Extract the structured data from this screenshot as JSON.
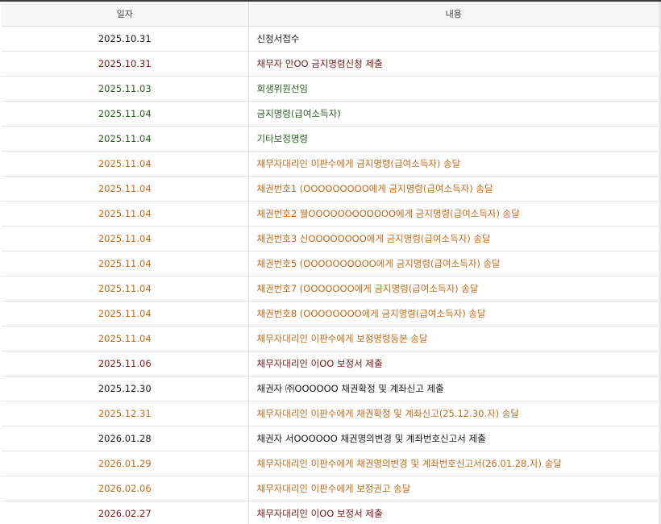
{
  "colors": {
    "black": "#1a1a1a",
    "red": "#7a1a18",
    "green": "#2b5e22",
    "orange": "#c46a17",
    "header_bg": "#f6f6f6"
  },
  "table": {
    "headers": {
      "date": "일자",
      "content": "내용"
    },
    "rows": [
      {
        "date": "2025.10.31",
        "content": "신청서접수",
        "color": "black"
      },
      {
        "date": "2025.10.31",
        "content": "채무자 안OO 금지명령신청 제출",
        "color": "red"
      },
      {
        "date": "2025.11.03",
        "content": "회생위원선임",
        "color": "green"
      },
      {
        "date": "2025.11.04",
        "content": "금지명령(급여소득자)",
        "color": "green"
      },
      {
        "date": "2025.11.04",
        "content": "기타보정명령",
        "color": "green"
      },
      {
        "date": "2025.11.04",
        "content": "채무자대리인 이판수에게 금지명령(급여소득자) 송달",
        "color": "orange"
      },
      {
        "date": "2025.11.04",
        "content": "채권번호1 (OOOOOOOOO에게 금지명령(급여소득자) 송달",
        "color": "orange"
      },
      {
        "date": "2025.11.04",
        "content": "채권번호2 웰OOOOOOOOOOOO에게 금지명령(급여소득자) 송달",
        "color": "orange"
      },
      {
        "date": "2025.11.04",
        "content": "채권번호3 신OOOOOOOO에게 금지명령(급여소득자) 송달",
        "color": "orange"
      },
      {
        "date": "2025.11.04",
        "content": "채권번호5 (OOOOOOOOOO에게 금지명령(급여소득자) 송달",
        "color": "orange"
      },
      {
        "date": "2025.11.04",
        "content": "채권번호7 (OOOOOOO에게 금지명령(급여소득자) 송달",
        "color": "orange"
      },
      {
        "date": "2025.11.04",
        "content": "채권번호8 (OOOOOOOO에게 금지명령(급여소득자) 송달",
        "color": "orange"
      },
      {
        "date": "2025.11.04",
        "content": "채무자대리인 이판수에게 보정명령등본 송달",
        "color": "orange"
      },
      {
        "date": "2025.11.06",
        "content": "채무자대리인 이OO 보정서 제출",
        "color": "red"
      },
      {
        "date": "2025.12.30",
        "content": "채권자 ㈜OOOOOO 채권확정 및 계좌신고 제출",
        "color": "black"
      },
      {
        "date": "2025.12.31",
        "content": "채무자대리인 이판수에게 채권확정 및 계좌신고(25.12.30.자) 송달",
        "color": "orange"
      },
      {
        "date": "2026.01.28",
        "content": "채권자 서OOOOOO 채권명의변경 및 계좌번호신고서 제출",
        "color": "black"
      },
      {
        "date": "2026.01.29",
        "content": "채무자대리인 이판수에게 채권명의변경 및 계좌번호신고서(26.01.28.자) 송달",
        "color": "orange"
      },
      {
        "date": "2026.02.06",
        "content": "채무자대리인 이판수에게 보정권고 송달",
        "color": "orange"
      },
      {
        "date": "2026.02.27",
        "content": "채무자대리인 이OO 보정서 제출",
        "color": "red"
      }
    ]
  }
}
